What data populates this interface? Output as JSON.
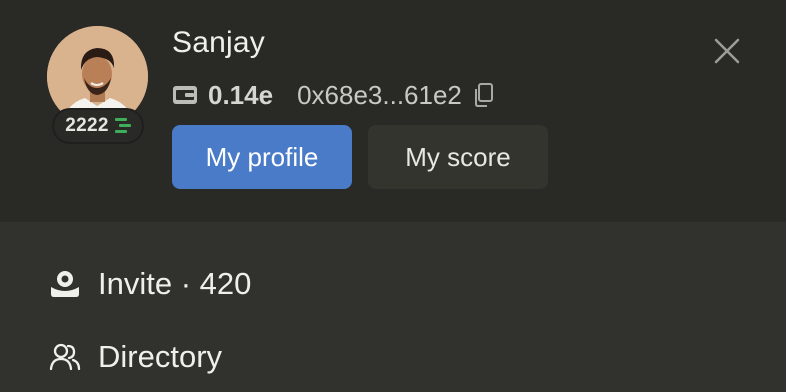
{
  "profile": {
    "name": "Sanjay",
    "score": "2222",
    "wallet_balance": "0.14e",
    "wallet_address": "0x68e3...61e2"
  },
  "buttons": {
    "my_profile": "My profile",
    "my_score": "My score"
  },
  "menu": {
    "invite": "Invite · 420",
    "directory": "Directory"
  },
  "icons": {
    "score": "score-bars-icon",
    "wallet": "wallet-icon",
    "copy": "copy-icon",
    "close": "close-icon",
    "invite": "invite-icon",
    "directory": "users-icon"
  },
  "colors": {
    "primary_button": "#4a7bc8",
    "score_icon": "#3fae5a",
    "header_bg": "#292926",
    "body_bg": "#31312d"
  }
}
